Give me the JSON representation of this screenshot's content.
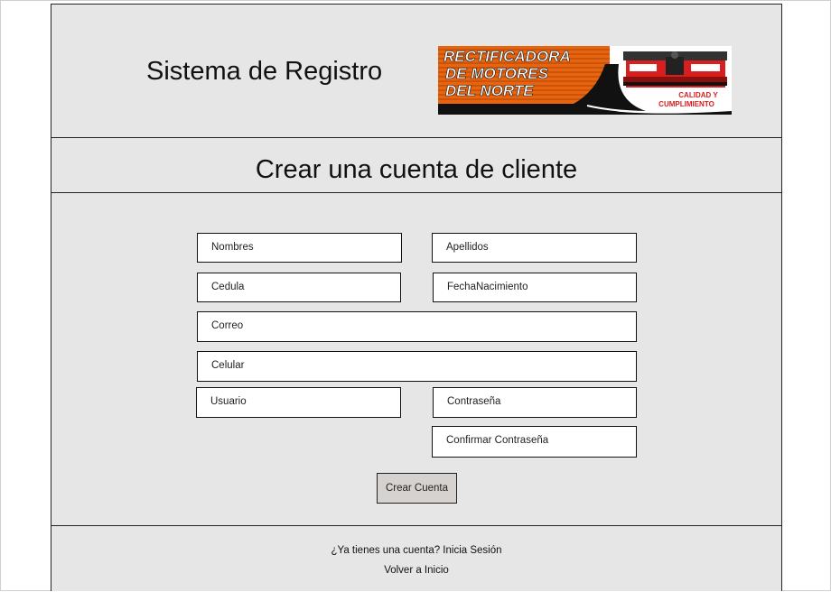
{
  "header": {
    "app_title": "Sistema de Registro",
    "logo": {
      "line1": "RECTIFICADORA",
      "line2": "DE MOTORES",
      "line3": "DEL NORTE",
      "tagline1": "CALIDAD Y",
      "tagline2": "CUMPLIMIENTO"
    }
  },
  "form": {
    "title": "Crear una cuenta de cliente",
    "fields": {
      "nombres": "Nombres",
      "apellidos": "Apellidos",
      "cedula": "Cedula",
      "fecha_nacimiento": "FechaNacimiento",
      "correo": "Correo",
      "celular": "Celular",
      "usuario": "Usuario",
      "contrasena": "Contraseña",
      "confirmar_contrasena": "Confirmar Contraseña"
    },
    "submit_label": "Crear Cuenta"
  },
  "footer": {
    "login_link": "¿Ya tienes una cuenta? Inicia Sesión",
    "home_link": "Volver a Inicio"
  },
  "colors": {
    "background": "#e6e6e6",
    "field_background": "#ffffff",
    "button_background": "#d6d2d0",
    "logo_orange": "#e8640f",
    "logo_red": "#d81e1e"
  }
}
